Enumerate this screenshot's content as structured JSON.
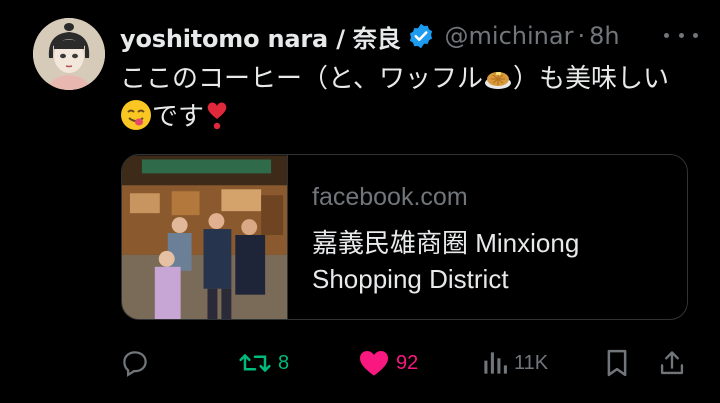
{
  "tweet": {
    "author": {
      "display_name": "yoshitomo nara / 奈良",
      "handle": "@michinar",
      "time": "8h"
    },
    "text": {
      "part1": "ここのコーヒー（と、ワッフル",
      "part2": "）も美味しい",
      "part3": "です"
    },
    "emojis": [
      "waffle-emoji",
      "yum-face-emoji",
      "heart-exclamation-emoji"
    ],
    "card": {
      "domain": "facebook.com",
      "title": "嘉義民雄商圈 Minxiong Shopping District"
    },
    "actions": {
      "reply_count": "",
      "retweet_count": "8",
      "like_count": "92",
      "views_count": "11K"
    }
  },
  "colors": {
    "background": "#000000",
    "text": "#e7e9ea",
    "secondary": "#71767b",
    "verified": "#1d9bf0",
    "retweet": "#00ba7c",
    "like": "#f91880",
    "border": "#2f3336"
  },
  "icons": [
    "avatar",
    "verified-badge-icon",
    "more-icon",
    "reply-icon",
    "retweet-icon",
    "like-icon",
    "views-icon",
    "bookmark-icon",
    "share-icon"
  ]
}
